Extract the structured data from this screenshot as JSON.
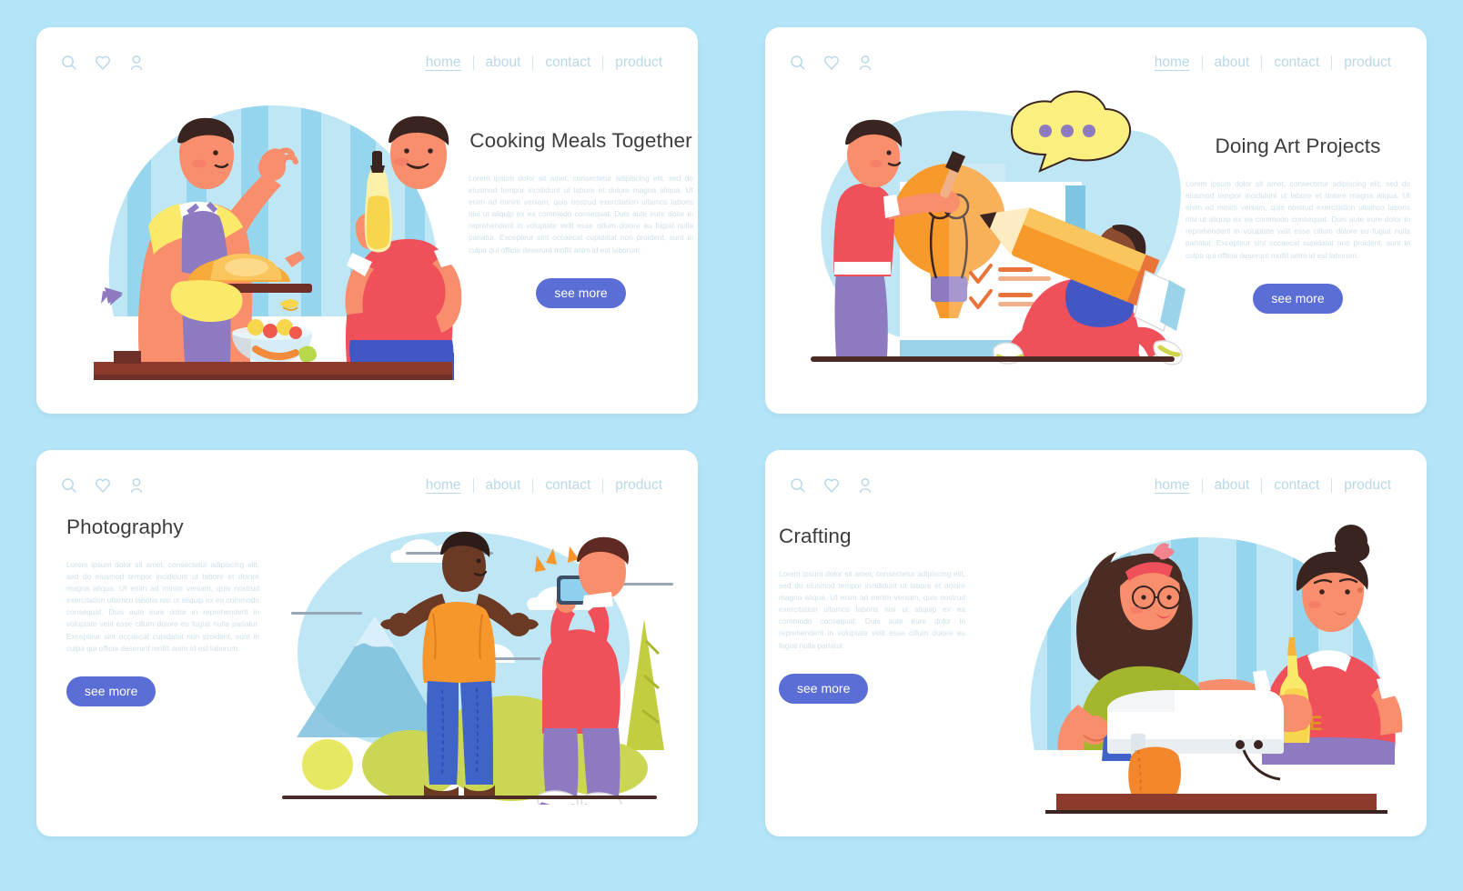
{
  "page": {
    "background_color": "#b3e4f7",
    "accent_button_color": "#5b6ed6",
    "title_color": "#3c3c3c",
    "body_text_color": "#cfe0ea",
    "nav_color": "#b9d8e6"
  },
  "nav": {
    "icons": [
      {
        "name": "search-icon",
        "label": "search"
      },
      {
        "name": "heart-icon",
        "label": "favorites"
      },
      {
        "name": "user-icon",
        "label": "account"
      }
    ],
    "links": [
      {
        "label": "home",
        "active": true
      },
      {
        "label": "about",
        "active": false
      },
      {
        "label": "contact",
        "active": false
      },
      {
        "label": "product",
        "active": false
      }
    ]
  },
  "cards": [
    {
      "id": "cooking",
      "title": "Cooking Meals Together",
      "body": "Lorem ipsum dolor sit amet, consectetur adipiscing elit, sed do eiusmod tempor incididunt ut labore et dolore magna aliqua. Ut enim ad minim veniam, quis nostrud exercitation ullamco laboris nisi ut aliquip ex ea commodo consequat. Duis aute irure dolor in reprehenderit in voluptate velit esse cillum dolore eu fugiat nulla pariatur. Excepteur sint occaecat cupidatat non proident, sunt in culpa qui officia deserunt mollit anim id est laborum.",
      "button": "see more",
      "illustration": "two-men-cooking-turkey-and-salad",
      "layout": "illustration-left"
    },
    {
      "id": "art-projects",
      "title": "Doing Art Projects",
      "body": "Lorem ipsum dolor sit amet, consectetur adipiscing elit, sed do eiusmod tempor incididunt ut labore et dolore magna aliqua. Ut enim ad minim veniam, quis nostrud exercitation ullamco laboris nisi ut aliquip ex ea commodo consequat. Duis aute irure dolor in reprehenderit in voluptate velit esse cillum dolore eu fugiat nulla pariatur. Excepteur sint occaecat cupidatat non proident, sunt in culpa qui officia deserunt mollit anim id est laborum.",
      "button": "see more",
      "illustration": "lightbulb-pencil-brush-artists",
      "layout": "illustration-left"
    },
    {
      "id": "photography",
      "title": "Photography",
      "body": "Lorem ipsum dolor sit amet, consectetur adipiscing elit, sed do eiusmod tempor incididunt ut labore et dolore magna aliqua. Ut enim ad minim veniam, quis nostrud exercitation ullamco laboris nisi ut aliquip ex ea commodo consequat. Duis aute irure dolor in reprehenderit in voluptate velit esse cillum dolore eu fugiat nulla pariatur. Excepteur sint occaecat cupidatat non proident, sunt in culpa qui officia deserunt mollit anim id est laborum.",
      "button": "see more",
      "illustration": "man-posing-photographer-mountains",
      "layout": "illustration-right"
    },
    {
      "id": "crafting",
      "title": "Crafting",
      "body": "Lorem ipsum dolor sit amet, consectetur adipiscing elit, sed do eiusmod tempor incididunt ut labore et dolore magna aliqua. Ut enim ad minim veniam, quis nostrud exercitation ullamco laboris nisi ut aliquip ex ea commodo consequat. Duis aute irure dolor in reprehenderit in voluptate velit esse cillum dolore eu fugiat nulla pariatur.",
      "button": "see more",
      "illustration": "two-women-sewing-machine-glue",
      "layout": "illustration-right"
    }
  ]
}
